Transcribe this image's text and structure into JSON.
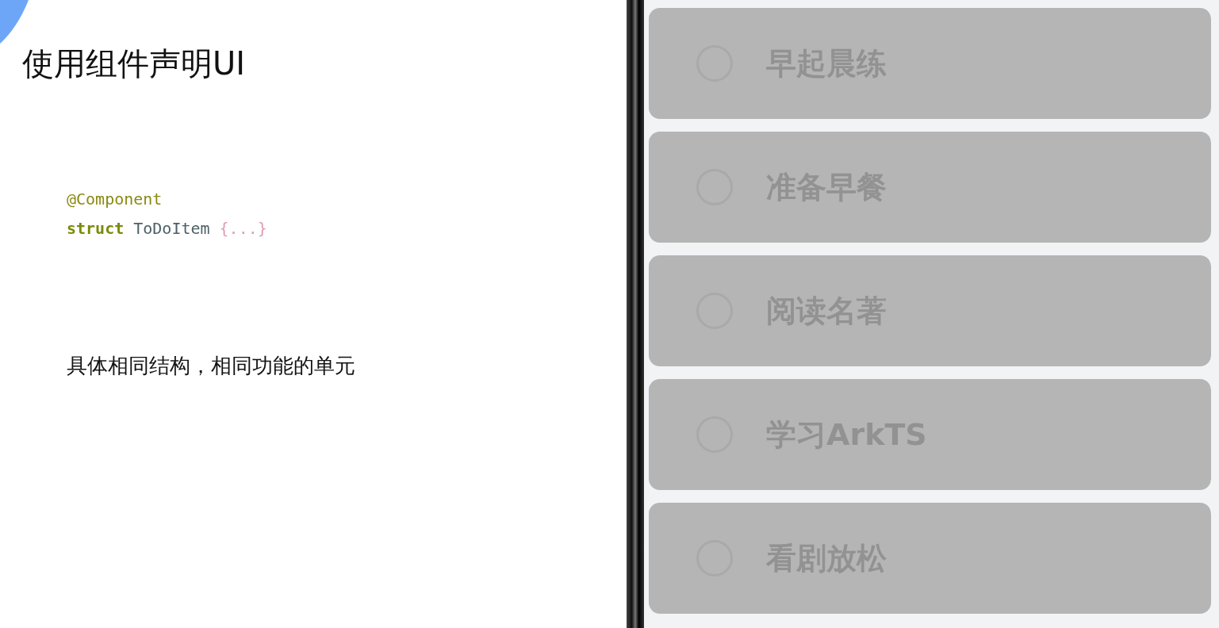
{
  "slide": {
    "title": "使用组件声明UI",
    "code_lines": [
      [
        {
          "kind": "annotation",
          "text": "@Component"
        }
      ],
      [
        {
          "kind": "keyword",
          "text": "struct"
        },
        {
          "kind": "identifier",
          "text": "ToDoItem"
        },
        {
          "kind": "punct",
          "text": "{...}"
        }
      ]
    ],
    "caption": "具体相同结构，相同功能的单元"
  },
  "todo_items": [
    {
      "label": "早起晨练",
      "checked": false
    },
    {
      "label": "准备早餐",
      "checked": false
    },
    {
      "label": "阅读名著",
      "checked": false
    },
    {
      "label": "学习ArkTS",
      "checked": false
    },
    {
      "label": "看剧放松",
      "checked": false
    }
  ]
}
